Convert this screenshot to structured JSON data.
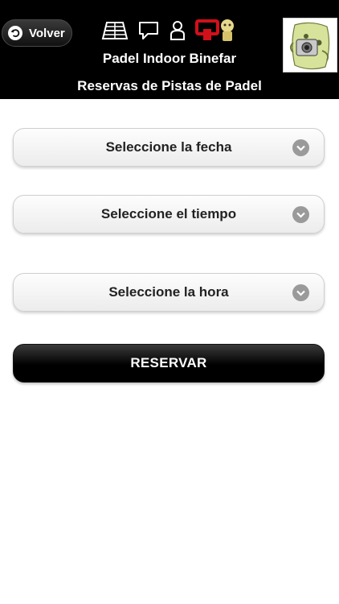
{
  "header": {
    "back_label": "Volver",
    "title": "Padel Indoor Binefar",
    "subtitle": "Reservas de Pistas de Padel",
    "icons": [
      "court-icon",
      "chat-icon",
      "user-icon",
      "club-logo-icon"
    ]
  },
  "form": {
    "date_select": "Seleccione la fecha",
    "time_select": "Seleccione el tiempo",
    "hour_select": "Seleccione la hora",
    "reserve_button": "RESERVAR"
  },
  "colors": {
    "header_bg": "#000000",
    "logo_red": "#d0101a",
    "chevron_gray": "#9a9a9a"
  }
}
